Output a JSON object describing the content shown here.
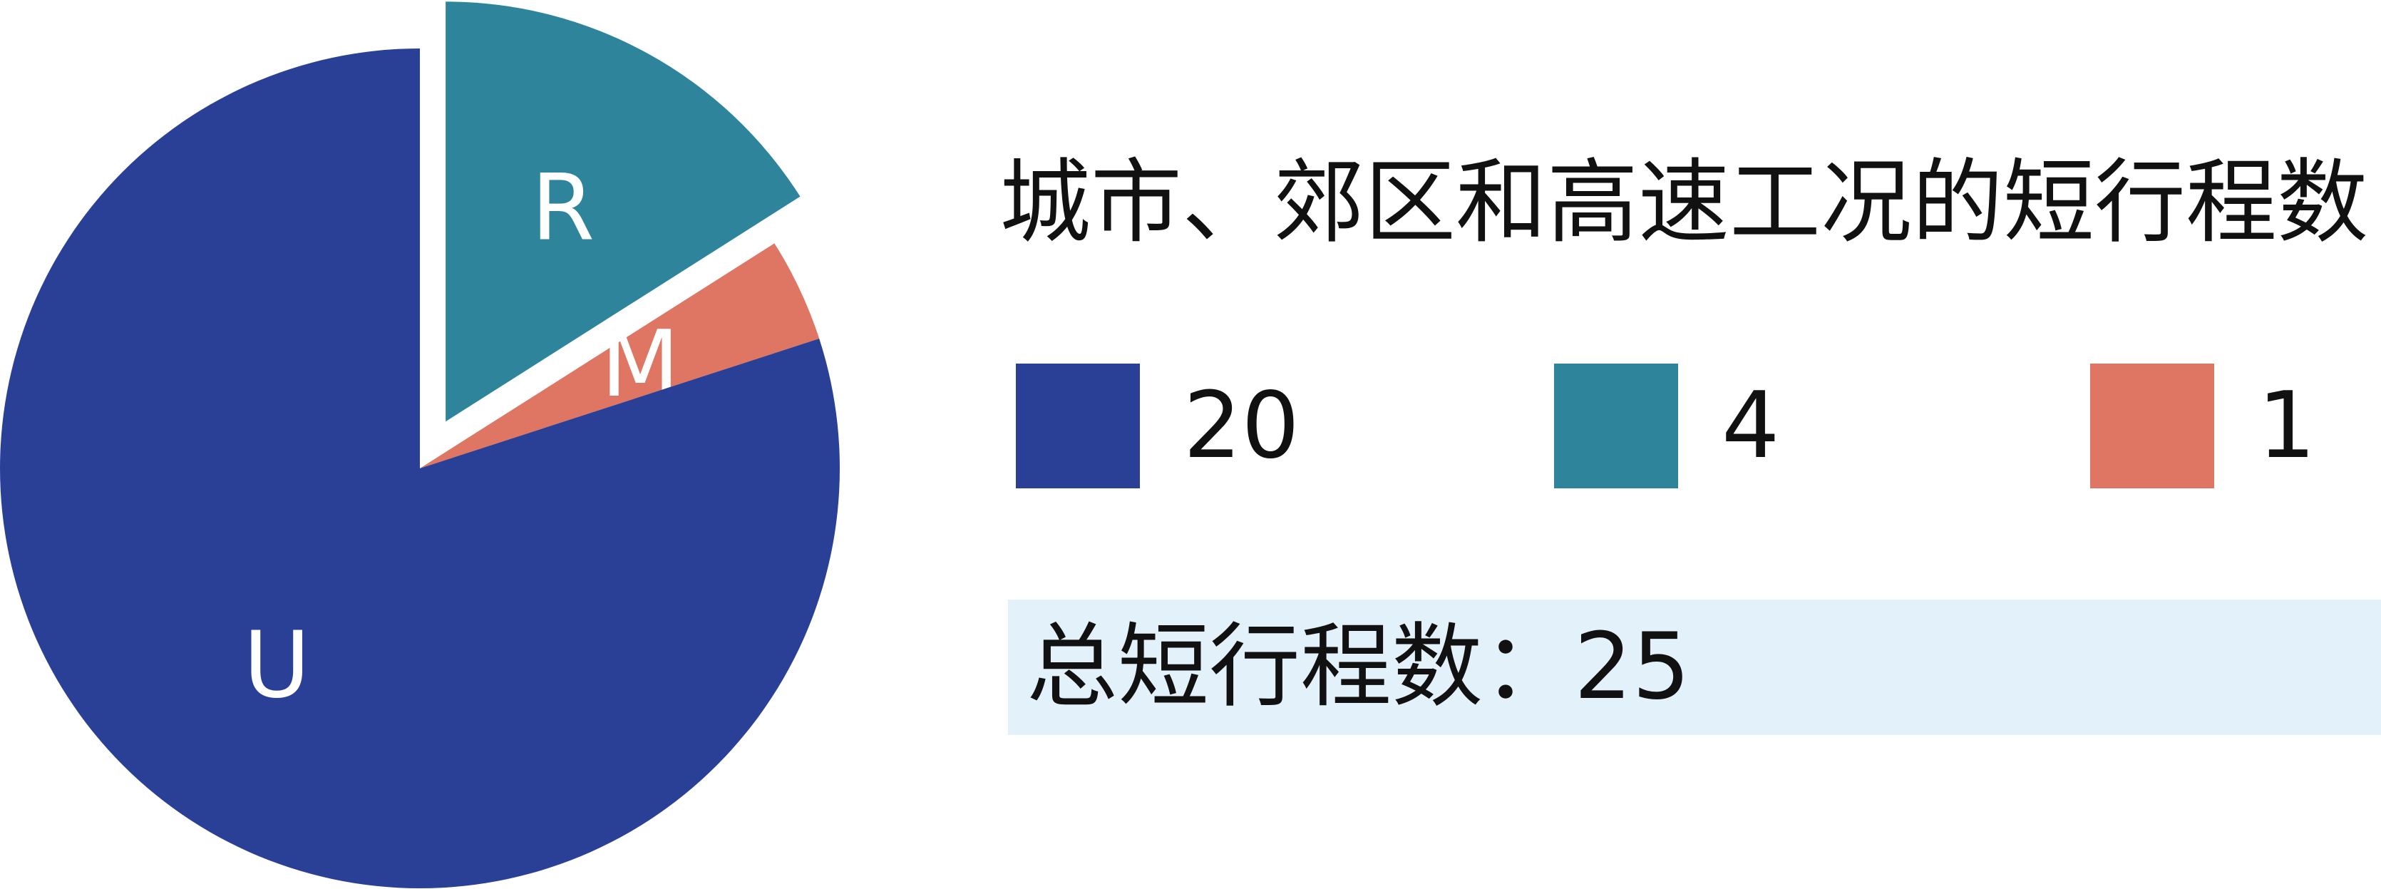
{
  "chart_data": {
    "type": "pie",
    "title": "城市、郊区和高速工况的短行程数",
    "slices": [
      {
        "label": "U",
        "value": 20,
        "color": "#2a4096",
        "exploded": false
      },
      {
        "label": "R",
        "value": 4,
        "color": "#2e859b",
        "exploded": true
      },
      {
        "label": "M",
        "value": 1,
        "color": "#df7563",
        "exploded": false
      }
    ],
    "legend": [
      {
        "value": "20",
        "color": "#2a4096"
      },
      {
        "value": "4",
        "color": "#2e859b"
      },
      {
        "value": "1",
        "color": "#df7563"
      }
    ],
    "total": {
      "label": "总短行程数",
      "separator": "：",
      "value": "25"
    }
  }
}
